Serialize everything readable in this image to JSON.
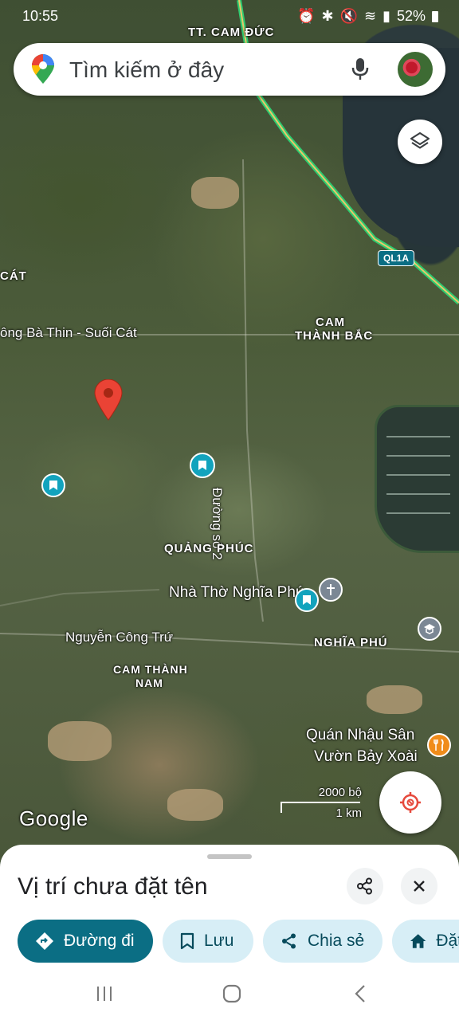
{
  "status_bar": {
    "time": "10:55",
    "battery": "52%"
  },
  "search": {
    "placeholder": "Tìm kiếm ở đây"
  },
  "map": {
    "road_badge": "QL1A",
    "labels": {
      "cam_duc": "TT. CAM ĐỨC",
      "cat": "CÁT",
      "ba_thin": "ông Bà Thin - Suối Cát",
      "cam_thanh_bac_1": "CAM",
      "cam_thanh_bac_2": "THÀNH BẮC",
      "duong_so_2": "Đường số 2",
      "quang_phuc": "QUẢNG PHÚC",
      "nha_tho": "Nhà Thờ Nghĩa Phú",
      "nguyen_cong_tru": "Nguyễn Công Trứ",
      "nghia_phu": "NGHĨA PHÚ",
      "cam_thanh_nam_1": "CAM THÀNH",
      "cam_thanh_nam_2": "NAM",
      "quan_nhau_1": "Quán Nhậu Sân",
      "quan_nhau_2": "Vườn Bảy Xoài",
      "google": "Google"
    },
    "scale": {
      "top": "2000 bộ",
      "bottom": "1 km"
    }
  },
  "sheet": {
    "title": "Vị trí chưa đặt tên",
    "actions": [
      {
        "label": "Đường đi",
        "icon": "directions-icon"
      },
      {
        "label": "Lưu",
        "icon": "bookmark-icon"
      },
      {
        "label": "Chia sẻ",
        "icon": "share-icon"
      },
      {
        "label": "Đặt",
        "icon": "home-icon"
      }
    ]
  },
  "colors": {
    "accent": "#0b6e84",
    "chip_secondary": "#d7eef6",
    "pin": "#ea4335",
    "poi_teal": "#12a3bd",
    "poi_orange": "#f08c1a",
    "highway": "#2ecc71"
  }
}
